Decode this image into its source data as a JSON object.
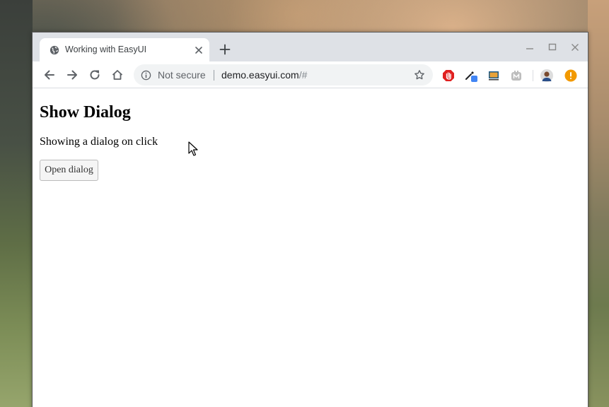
{
  "browser": {
    "tab": {
      "title": "Working with EasyUI",
      "favicon": "globe-icon"
    },
    "omnibox": {
      "security_label": "Not secure",
      "url_host": "demo.easyui.com",
      "url_path": "/#"
    },
    "extensions": [
      "stop-hand-icon",
      "color-picker-icon",
      "screen-capture-icon",
      "m-extension-icon",
      "profile-avatar-icon",
      "alert-icon"
    ]
  },
  "page": {
    "title": "Show Dialog",
    "description": "Showing a dialog on click",
    "button_label": "Open dialog"
  },
  "colors": {
    "tabstrip": "#dee1e6",
    "omnibox": "#f1f3f4",
    "stop_red": "#e02020",
    "alert_orange": "#f29900",
    "picker_blue": "#4285f4"
  }
}
